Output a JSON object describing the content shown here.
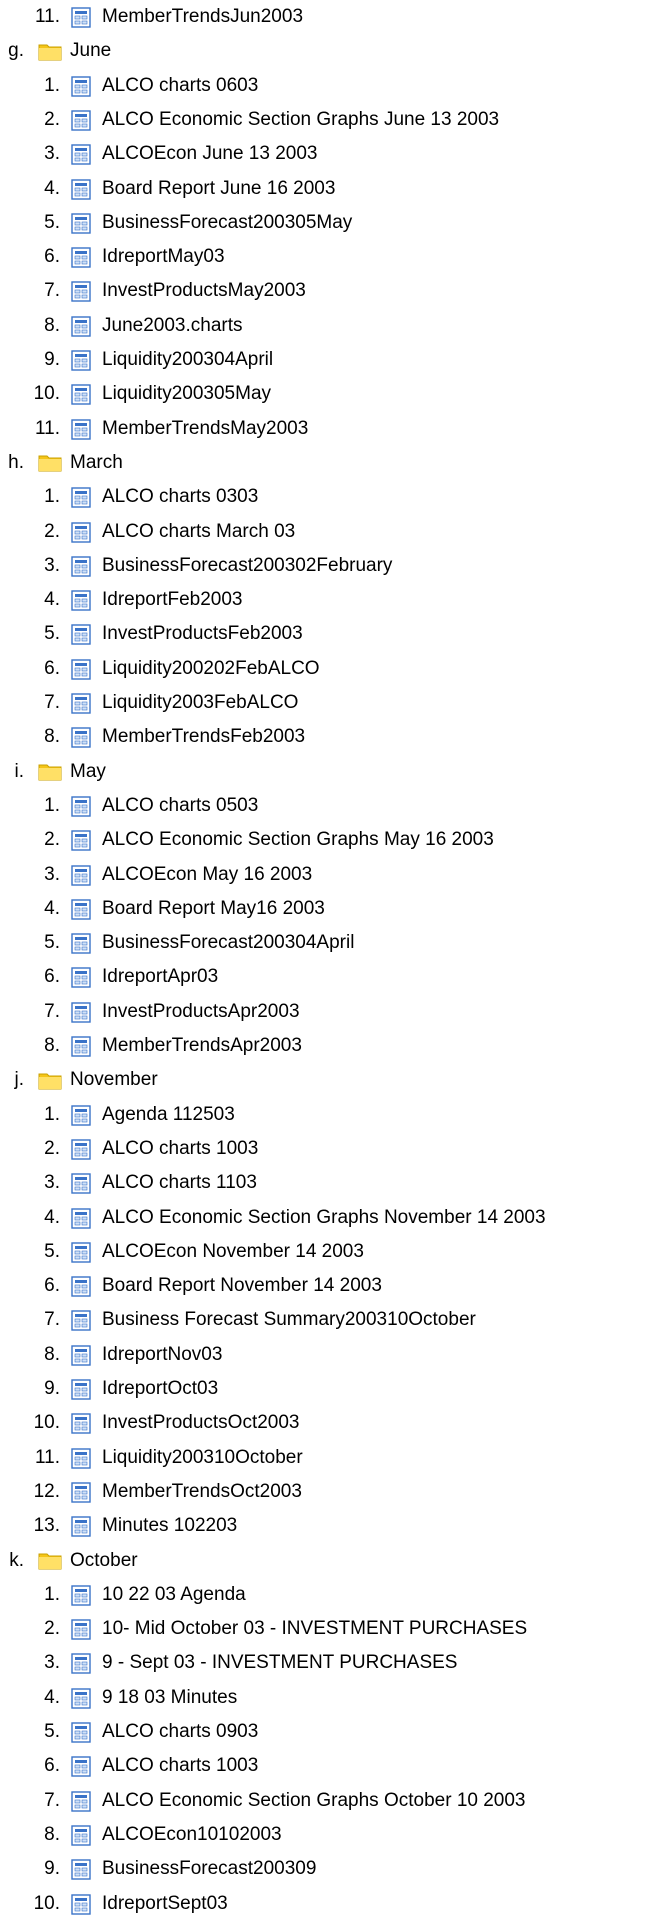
{
  "tree": [
    {
      "type": "file",
      "marker": "11.",
      "label": "MemberTrendsJun2003",
      "icon": "document-icon"
    },
    {
      "type": "folder",
      "marker": "g.",
      "label": "June",
      "icon": "folder-icon"
    },
    {
      "type": "file",
      "marker": "1.",
      "label": "ALCO charts 0603",
      "icon": "document-icon"
    },
    {
      "type": "file",
      "marker": "2.",
      "label": "ALCO Economic Section Graphs June 13 2003",
      "icon": "document-icon"
    },
    {
      "type": "file",
      "marker": "3.",
      "label": "ALCOEcon June 13 2003",
      "icon": "document-icon"
    },
    {
      "type": "file",
      "marker": "4.",
      "label": "Board Report June 16 2003",
      "icon": "document-icon"
    },
    {
      "type": "file",
      "marker": "5.",
      "label": "BusinessForecast200305May",
      "icon": "document-icon"
    },
    {
      "type": "file",
      "marker": "6.",
      "label": "IdreportMay03",
      "icon": "document-icon"
    },
    {
      "type": "file",
      "marker": "7.",
      "label": "InvestProductsMay2003",
      "icon": "document-icon"
    },
    {
      "type": "file",
      "marker": "8.",
      "label": "June2003.charts",
      "icon": "document-icon"
    },
    {
      "type": "file",
      "marker": "9.",
      "label": "Liquidity200304April",
      "icon": "document-icon"
    },
    {
      "type": "file",
      "marker": "10.",
      "label": "Liquidity200305May",
      "icon": "document-icon"
    },
    {
      "type": "file",
      "marker": "11.",
      "label": "MemberTrendsMay2003",
      "icon": "document-icon"
    },
    {
      "type": "folder",
      "marker": "h.",
      "label": "March",
      "icon": "folder-icon"
    },
    {
      "type": "file",
      "marker": "1.",
      "label": "ALCO charts 0303",
      "icon": "document-icon"
    },
    {
      "type": "file",
      "marker": "2.",
      "label": "ALCO charts March 03",
      "icon": "document-icon"
    },
    {
      "type": "file",
      "marker": "3.",
      "label": "BusinessForecast200302February",
      "icon": "document-icon"
    },
    {
      "type": "file",
      "marker": "4.",
      "label": "IdreportFeb2003",
      "icon": "document-icon"
    },
    {
      "type": "file",
      "marker": "5.",
      "label": "InvestProductsFeb2003",
      "icon": "document-icon"
    },
    {
      "type": "file",
      "marker": "6.",
      "label": "Liquidity200202FebALCO",
      "icon": "document-icon"
    },
    {
      "type": "file",
      "marker": "7.",
      "label": "Liquidity2003FebALCO",
      "icon": "document-icon"
    },
    {
      "type": "file",
      "marker": "8.",
      "label": "MemberTrendsFeb2003",
      "icon": "document-icon"
    },
    {
      "type": "folder",
      "marker": "i.",
      "label": "May",
      "icon": "folder-icon"
    },
    {
      "type": "file",
      "marker": "1.",
      "label": "ALCO charts 0503",
      "icon": "document-icon"
    },
    {
      "type": "file",
      "marker": "2.",
      "label": "ALCO Economic Section Graphs May 16 2003",
      "icon": "document-icon"
    },
    {
      "type": "file",
      "marker": "3.",
      "label": "ALCOEcon May 16 2003",
      "icon": "document-icon"
    },
    {
      "type": "file",
      "marker": "4.",
      "label": "Board Report May16 2003",
      "icon": "document-icon"
    },
    {
      "type": "file",
      "marker": "5.",
      "label": "BusinessForecast200304April",
      "icon": "document-icon"
    },
    {
      "type": "file",
      "marker": "6.",
      "label": "IdreportApr03",
      "icon": "document-icon"
    },
    {
      "type": "file",
      "marker": "7.",
      "label": "InvestProductsApr2003",
      "icon": "document-icon"
    },
    {
      "type": "file",
      "marker": "8.",
      "label": "MemberTrendsApr2003",
      "icon": "document-icon"
    },
    {
      "type": "folder",
      "marker": "j.",
      "label": "November",
      "icon": "folder-icon"
    },
    {
      "type": "file",
      "marker": "1.",
      "label": "Agenda 112503",
      "icon": "document-icon"
    },
    {
      "type": "file",
      "marker": "2.",
      "label": "ALCO charts 1003",
      "icon": "document-icon"
    },
    {
      "type": "file",
      "marker": "3.",
      "label": "ALCO charts 1103",
      "icon": "document-icon"
    },
    {
      "type": "file",
      "marker": "4.",
      "label": "ALCO Economic Section Graphs November 14 2003",
      "icon": "document-icon"
    },
    {
      "type": "file",
      "marker": "5.",
      "label": "ALCOEcon November 14 2003",
      "icon": "document-icon"
    },
    {
      "type": "file",
      "marker": "6.",
      "label": "Board Report November 14 2003",
      "icon": "document-icon"
    },
    {
      "type": "file",
      "marker": "7.",
      "label": "Business Forecast Summary200310October",
      "icon": "document-icon"
    },
    {
      "type": "file",
      "marker": "8.",
      "label": "IdreportNov03",
      "icon": "document-icon"
    },
    {
      "type": "file",
      "marker": "9.",
      "label": "IdreportOct03",
      "icon": "document-icon"
    },
    {
      "type": "file",
      "marker": "10.",
      "label": "InvestProductsOct2003",
      "icon": "document-icon"
    },
    {
      "type": "file",
      "marker": "11.",
      "label": "Liquidity200310October",
      "icon": "document-icon"
    },
    {
      "type": "file",
      "marker": "12.",
      "label": "MemberTrendsOct2003",
      "icon": "document-icon"
    },
    {
      "type": "file",
      "marker": "13.",
      "label": "Minutes 102203",
      "icon": "document-icon"
    },
    {
      "type": "folder",
      "marker": "k.",
      "label": "October",
      "icon": "folder-icon"
    },
    {
      "type": "file",
      "marker": "1.",
      "label": "10 22 03 Agenda",
      "icon": "document-icon"
    },
    {
      "type": "file",
      "marker": "2.",
      "label": "10- Mid October 03 - INVESTMENT PURCHASES",
      "icon": "document-icon"
    },
    {
      "type": "file",
      "marker": "3.",
      "label": "9 - Sept 03 - INVESTMENT PURCHASES",
      "icon": "document-icon"
    },
    {
      "type": "file",
      "marker": "4.",
      "label": "9 18 03 Minutes",
      "icon": "document-icon"
    },
    {
      "type": "file",
      "marker": "5.",
      "label": "ALCO charts 0903",
      "icon": "document-icon"
    },
    {
      "type": "file",
      "marker": "6.",
      "label": "ALCO charts 1003",
      "icon": "document-icon"
    },
    {
      "type": "file",
      "marker": "7.",
      "label": "ALCO Economic Section Graphs October 10 2003",
      "icon": "document-icon"
    },
    {
      "type": "file",
      "marker": "8.",
      "label": "ALCOEcon10102003",
      "icon": "document-icon"
    },
    {
      "type": "file",
      "marker": "9.",
      "label": "BusinessForecast200309",
      "icon": "document-icon"
    },
    {
      "type": "file",
      "marker": "10.",
      "label": "IdreportSept03",
      "icon": "document-icon"
    }
  ],
  "colors": {
    "folder": "#f5c518",
    "folder_edge": "#c9a000",
    "doc_blue": "#3a73c8",
    "doc_light": "#cfe0f7"
  }
}
